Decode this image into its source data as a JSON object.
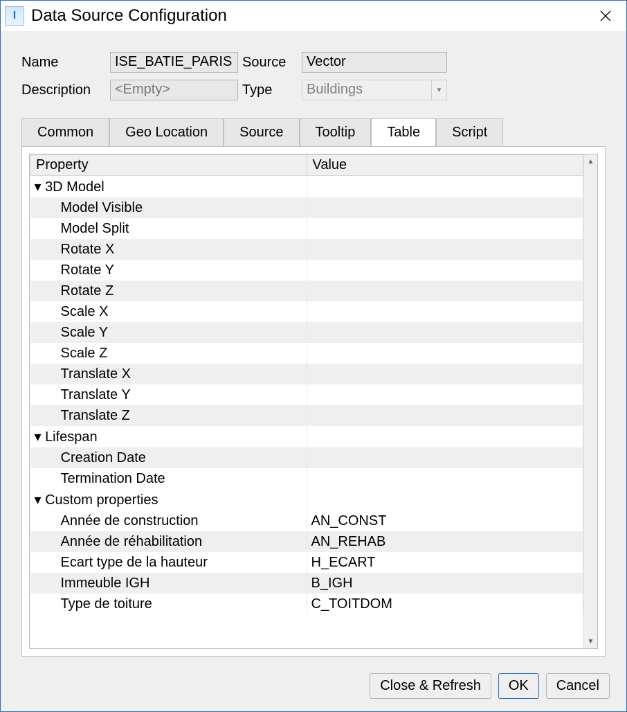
{
  "window": {
    "title": "Data Source Configuration"
  },
  "form": {
    "name_label": "Name",
    "name_value": "ISE_BATIE_PARIS",
    "source_label": "Source",
    "source_value": "Vector",
    "description_label": "Description",
    "description_placeholder": "<Empty>",
    "type_label": "Type",
    "type_value": "Buildings"
  },
  "tabs": {
    "common": "Common",
    "geo": "Geo Location",
    "source": "Source",
    "tooltip": "Tooltip",
    "table": "Table",
    "script": "Script",
    "active": "table"
  },
  "table": {
    "col_property": "Property",
    "col_value": "Value",
    "groups": [
      {
        "name": "3D Model",
        "rows": [
          {
            "prop": "Model Visible",
            "val": ""
          },
          {
            "prop": "Model Split",
            "val": ""
          },
          {
            "prop": "Rotate X",
            "val": ""
          },
          {
            "prop": "Rotate Y",
            "val": ""
          },
          {
            "prop": "Rotate Z",
            "val": ""
          },
          {
            "prop": "Scale X",
            "val": ""
          },
          {
            "prop": "Scale Y",
            "val": ""
          },
          {
            "prop": "Scale Z",
            "val": ""
          },
          {
            "prop": "Translate X",
            "val": ""
          },
          {
            "prop": "Translate Y",
            "val": ""
          },
          {
            "prop": "Translate Z",
            "val": ""
          }
        ]
      },
      {
        "name": "Lifespan",
        "rows": [
          {
            "prop": "Creation Date",
            "val": ""
          },
          {
            "prop": "Termination Date",
            "val": ""
          }
        ]
      },
      {
        "name": "Custom properties",
        "rows": [
          {
            "prop": "Année de construction",
            "val": "AN_CONST"
          },
          {
            "prop": "Année de réhabilitation",
            "val": "AN_REHAB"
          },
          {
            "prop": "Ecart type de la hauteur",
            "val": "H_ECART"
          },
          {
            "prop": "Immeuble IGH",
            "val": "B_IGH"
          },
          {
            "prop": "Type de toiture",
            "val": "C_TOITDOM"
          }
        ]
      }
    ]
  },
  "buttons": {
    "close_refresh": "Close & Refresh",
    "ok": "OK",
    "cancel": "Cancel"
  }
}
